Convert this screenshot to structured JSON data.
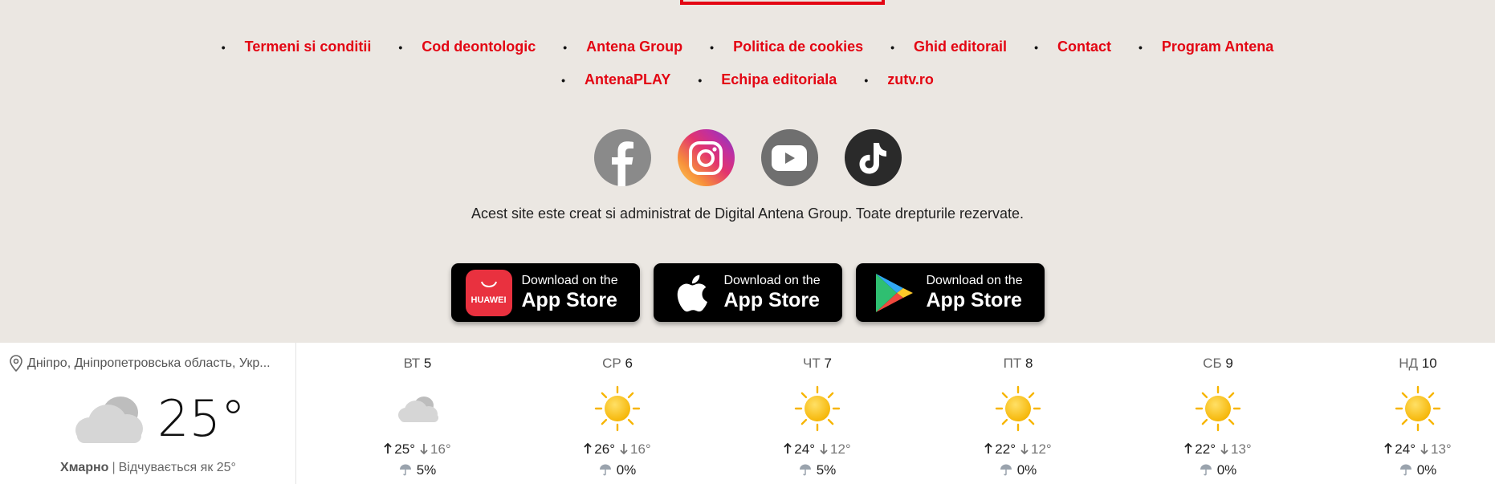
{
  "footer": {
    "links_row1": [
      "Termeni si conditii",
      "Cod deontologic",
      "Antena Group",
      "Politica de cookies",
      "Ghid editorail",
      "Contact",
      "Program Antena"
    ],
    "links_row2": [
      "AntenaPLAY",
      "Echipa editoriala",
      "zutv.ro"
    ],
    "bullet": "•",
    "socials": [
      "facebook-icon",
      "instagram-icon",
      "youtube-icon",
      "tiktok-icon"
    ],
    "copyright": "Acest site este creat si administrat de Digital Antena Group. Toate drepturile rezervate.",
    "stores": [
      {
        "icon": "huawei-appgallery-icon",
        "brand": "HUAWEI",
        "small": "Download on the",
        "big": "App Store"
      },
      {
        "icon": "apple-icon",
        "small": "Download on the",
        "big": "App Store"
      },
      {
        "icon": "google-play-icon",
        "small": "Download on the",
        "big": "App Store"
      }
    ],
    "link_color": "#e30613"
  },
  "weather": {
    "location": "Дніпро, Дніпропетровська область, Укр...",
    "current_temp": "25°",
    "current_icon": "cloudy-icon",
    "condition": "Хмарно",
    "separator": "|",
    "feels_like": "Відчувається як 25°",
    "days": [
      {
        "dow": "ВТ",
        "date": "5",
        "icon": "cloudy-icon",
        "hi": "25°",
        "lo": "16°",
        "rain": "5%"
      },
      {
        "dow": "СР",
        "date": "6",
        "icon": "sunny-icon",
        "hi": "26°",
        "lo": "16°",
        "rain": "0%"
      },
      {
        "dow": "ЧТ",
        "date": "7",
        "icon": "sunny-icon",
        "hi": "24°",
        "lo": "12°",
        "rain": "5%"
      },
      {
        "dow": "ПТ",
        "date": "8",
        "icon": "sunny-icon",
        "hi": "22°",
        "lo": "12°",
        "rain": "0%"
      },
      {
        "dow": "СБ",
        "date": "9",
        "icon": "sunny-icon",
        "hi": "22°",
        "lo": "13°",
        "rain": "0%"
      },
      {
        "dow": "НД",
        "date": "10",
        "icon": "sunny-icon",
        "hi": "24°",
        "lo": "13°",
        "rain": "0%"
      }
    ]
  }
}
